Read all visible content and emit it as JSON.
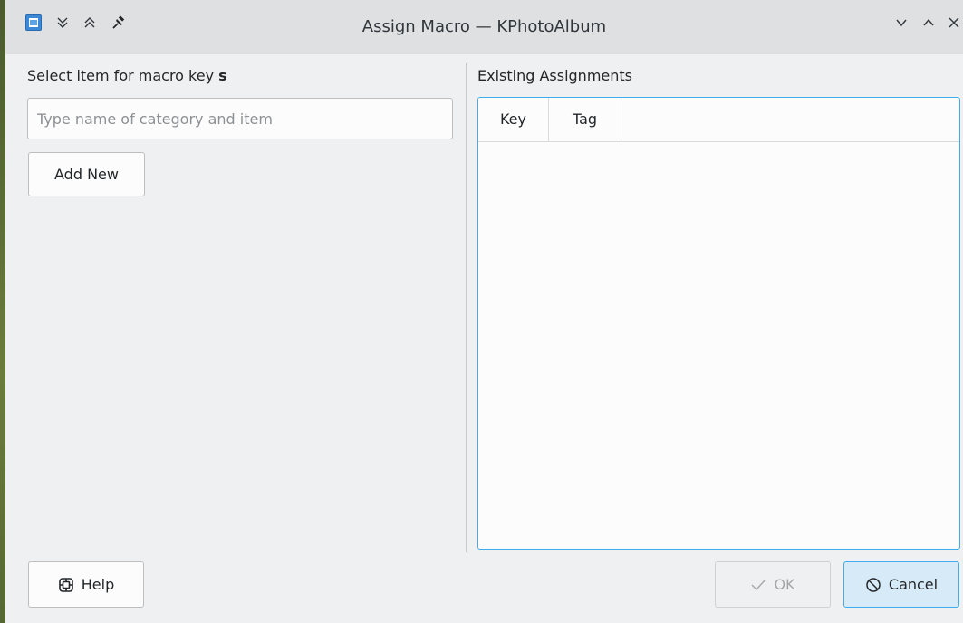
{
  "window": {
    "title": "Assign Macro — KPhotoAlbum"
  },
  "titlebar": {
    "icons": [
      "app-icon",
      "keep-below-icon",
      "keep-above-icon",
      "pin-icon",
      "minimize-icon",
      "maximize-icon",
      "close-icon"
    ]
  },
  "left": {
    "label_prefix": "Select item for macro key ",
    "label_key": "s",
    "search_placeholder": "Type name of category and item",
    "search_value": "",
    "add_new_label": "Add New"
  },
  "right": {
    "label": "Existing Assignments",
    "columns": [
      "Key",
      "Tag"
    ],
    "rows": []
  },
  "footer": {
    "help_label": "Help",
    "help_icon": "help-lifebuoy-icon",
    "ok_label": "OK",
    "ok_icon": "check-icon",
    "ok_enabled": false,
    "cancel_label": "Cancel",
    "cancel_icon": "cancel-icon"
  },
  "colors": {
    "accent": "#3daee9",
    "window_bg": "#eff0f1",
    "titlebar_bg": "#dee0e2",
    "cancel_bg": "#d6eaf7"
  }
}
